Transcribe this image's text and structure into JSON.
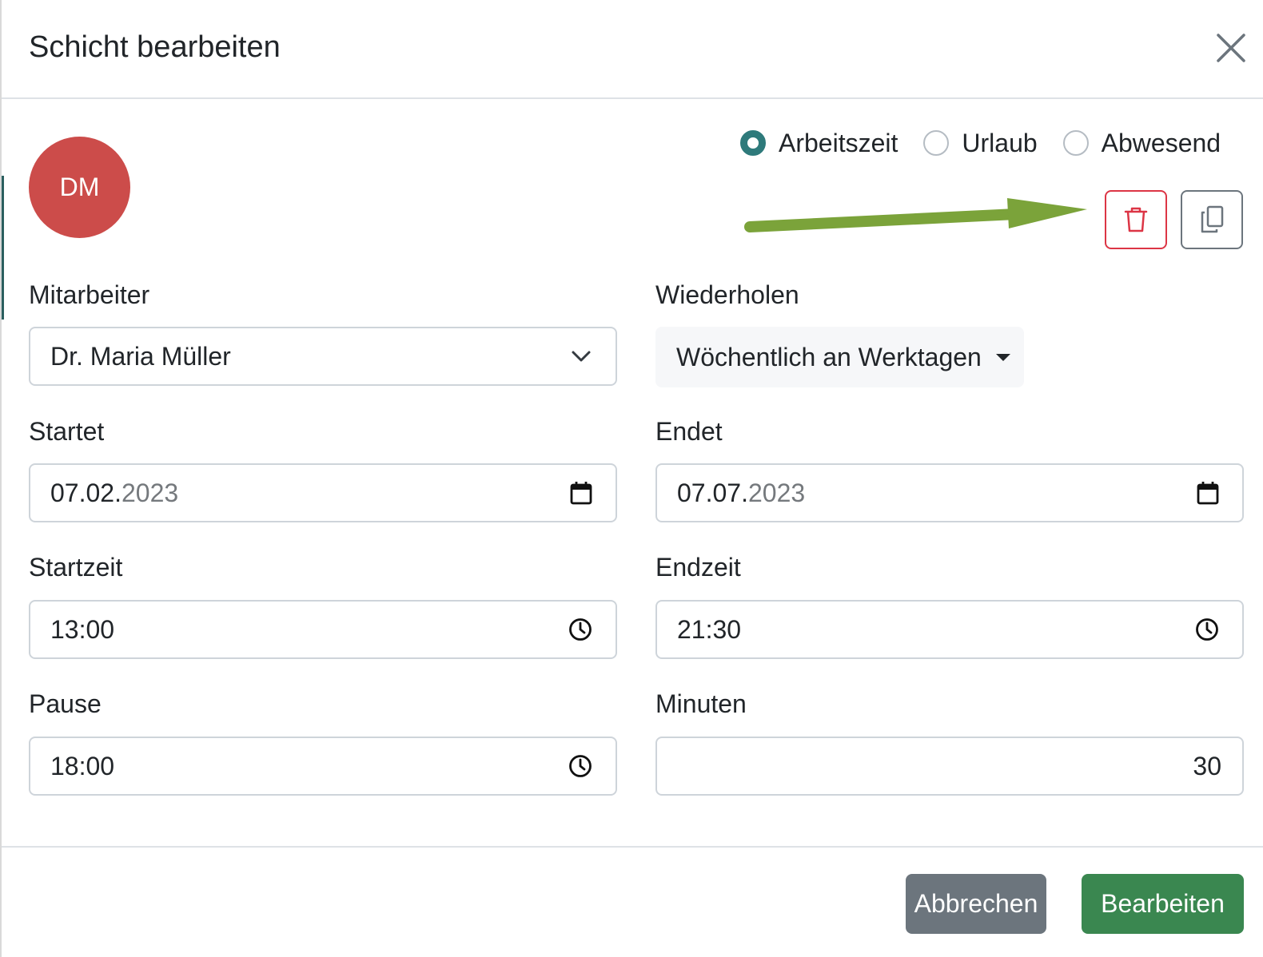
{
  "header": {
    "title": "Schicht bearbeiten"
  },
  "employee": {
    "initials": "DM",
    "avatar_color": "#cc4c4a"
  },
  "type_options": [
    {
      "label": "Arbeitszeit",
      "checked": true
    },
    {
      "label": "Urlaub",
      "checked": false
    },
    {
      "label": "Abwesend",
      "checked": false
    }
  ],
  "actions": {
    "delete_icon": "trash-icon",
    "copy_icon": "copy-icon",
    "delete_color": "#dc3545",
    "annotation_arrow_color": "#7ba33a"
  },
  "form": {
    "employee_label": "Mitarbeiter",
    "employee_value": "Dr. Maria Müller",
    "repeat_label": "Wiederholen",
    "repeat_value": "Wöchentlich an Werktagen",
    "start_label": "Startet",
    "start_value_main": "07.02.",
    "start_value_year": "2023",
    "end_label": "Endet",
    "end_value_main": "07.07.",
    "end_value_year": "2023",
    "start_time_label": "Startzeit",
    "start_time_value": "13:00",
    "end_time_label": "Endzeit",
    "end_time_value": "21:30",
    "pause_label": "Pause",
    "pause_value": "18:00",
    "minutes_label": "Minuten",
    "minutes_value": "30"
  },
  "footer": {
    "cancel_label": "Abbrechen",
    "submit_label": "Bearbeiten",
    "cancel_color": "#6c757d",
    "submit_color": "#3a8750"
  }
}
